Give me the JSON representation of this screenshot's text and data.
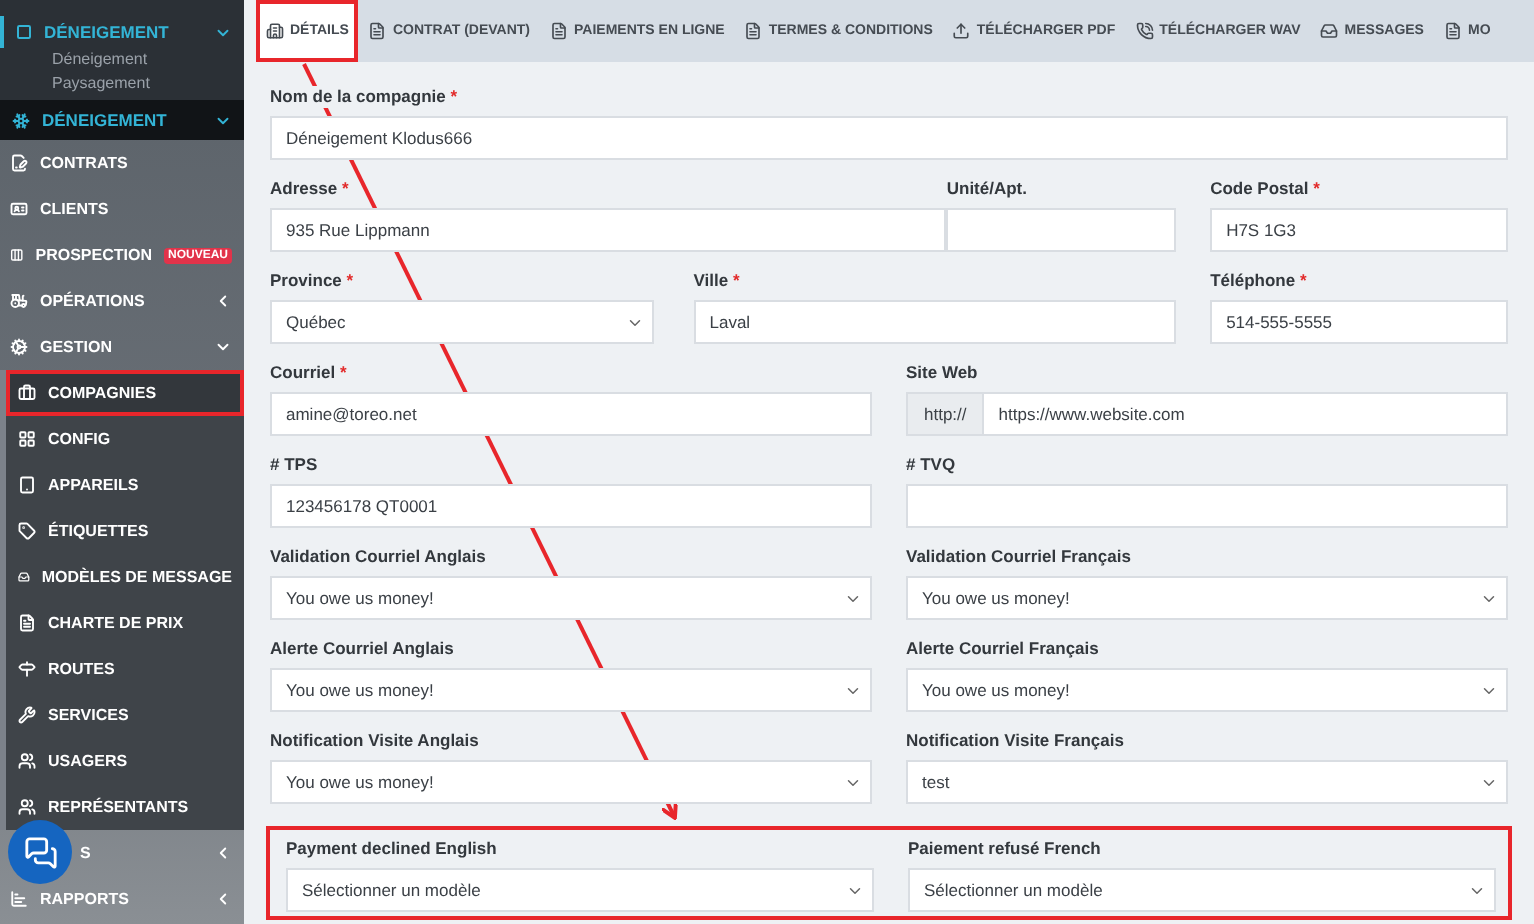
{
  "sidebar": {
    "top_menu": {
      "label": "DÉNEIGEMENT",
      "expanded": true,
      "children": [
        {
          "label": "Déneigement"
        },
        {
          "label": "Paysagement"
        }
      ]
    },
    "app_header": {
      "label": "DÉNEIGEMENT",
      "expanded": true
    },
    "items": [
      {
        "label": "CONTRATS"
      },
      {
        "label": "CLIENTS"
      },
      {
        "label": "PROSPECTION",
        "badge": "NOUVEAU"
      },
      {
        "label": "OPÉRATIONS",
        "expanded": false
      },
      {
        "label": "GESTION",
        "expanded": true,
        "children": [
          {
            "label": "COMPAGNIES",
            "selected": true,
            "highlighted": true
          },
          {
            "label": "CONFIG",
            "selected": false,
            "highlighted": false
          },
          {
            "label": "APPAREILS",
            "selected": false,
            "highlighted": false
          },
          {
            "label": "ÉTIQUETTES",
            "selected": false,
            "highlighted": false
          },
          {
            "label": "MODÈLES DE MESSAGE",
            "selected": false,
            "highlighted": false
          },
          {
            "label": "CHARTE DE PRIX",
            "selected": false,
            "highlighted": false
          },
          {
            "label": "ROUTES",
            "selected": false,
            "highlighted": false
          },
          {
            "label": "SERVICES",
            "selected": false,
            "highlighted": false
          },
          {
            "label": "USAGERS",
            "selected": false,
            "highlighted": false
          },
          {
            "label": "REPRÉSENTANTS",
            "selected": false,
            "highlighted": false
          }
        ]
      },
      {
        "label": "S",
        "expanded": false,
        "obscured": true
      },
      {
        "label": "RAPPORTS",
        "expanded": false
      }
    ]
  },
  "tabs": [
    {
      "label": "DÉTAILS",
      "selected": true,
      "highlighted": true
    },
    {
      "label": "CONTRAT (DEVANT)",
      "selected": false,
      "highlighted": false
    },
    {
      "label": "PAIEMENTS EN LIGNE",
      "selected": false,
      "highlighted": false
    },
    {
      "label": "TERMES & CONDITIONS",
      "selected": false,
      "highlighted": false
    },
    {
      "label": "TÉLÉCHARGER PDF",
      "selected": false,
      "highlighted": false
    },
    {
      "label": "TÉLÉCHARGER WAV",
      "selected": false,
      "highlighted": false
    },
    {
      "label": "MESSAGES",
      "selected": false,
      "highlighted": false
    },
    {
      "label": "MO",
      "selected": false,
      "highlighted": false
    }
  ],
  "form": {
    "rows": [
      {
        "highlighted": false,
        "fields": [
          {
            "kind": "text",
            "label": "Nom de la compagnie",
            "mark": "*",
            "value": "Déneigement Klodus666"
          }
        ]
      },
      {
        "highlighted": false,
        "fields": [
          {
            "kind": "text",
            "label": "Adresse",
            "mark": "*",
            "value": "935 Rue Lippmann"
          },
          {
            "kind": "text",
            "label": "Unité/Apt."
          },
          {
            "kind": "text",
            "label": "Code Postal",
            "mark": "*",
            "value": "H7S 1G3"
          }
        ]
      },
      {
        "highlighted": false,
        "fields": [
          {
            "kind": "select",
            "label": "Province",
            "mark": "*",
            "value": "Québec"
          },
          {
            "kind": "text",
            "label": "Ville",
            "mark": "*",
            "value": "Laval"
          },
          {
            "kind": "text",
            "label": "Téléphone",
            "mark": "*",
            "value": "514-555-5555"
          }
        ]
      },
      {
        "highlighted": false,
        "fields": [
          {
            "kind": "text",
            "label": "Courriel",
            "mark": "*",
            "value": "amine@toreo.net"
          },
          {
            "kind": "addon",
            "label": "Site Web",
            "addon": "http://",
            "value": "https://www.website.com"
          }
        ]
      },
      {
        "highlighted": false,
        "fields": [
          {
            "kind": "text",
            "label": "# TPS",
            "value": "123456178 QT0001"
          },
          {
            "kind": "text",
            "label": "# TVQ"
          }
        ]
      },
      {
        "highlighted": false,
        "fields": [
          {
            "kind": "select",
            "label": "Validation Courriel Anglais",
            "value": "You owe us money!"
          },
          {
            "kind": "select",
            "label": "Validation Courriel Français",
            "value": "You owe us money!"
          }
        ]
      },
      {
        "highlighted": false,
        "fields": [
          {
            "kind": "select",
            "label": "Alerte Courriel Anglais",
            "value": "You owe us money!"
          },
          {
            "kind": "select",
            "label": "Alerte Courriel Français",
            "value": "You owe us money!"
          }
        ]
      },
      {
        "highlighted": false,
        "fields": [
          {
            "kind": "select",
            "label": "Notification Visite Anglais",
            "value": "You owe us money!"
          },
          {
            "kind": "select",
            "label": "Notification Visite Français",
            "value": "test"
          }
        ]
      },
      {
        "highlighted": true,
        "fields": [
          {
            "kind": "select",
            "label": "Payment declined English",
            "value": "Sélectionner un modèle"
          },
          {
            "kind": "select",
            "label": "Paiement refusé French",
            "value": "Sélectionner un modèle"
          }
        ]
      }
    ]
  }
}
